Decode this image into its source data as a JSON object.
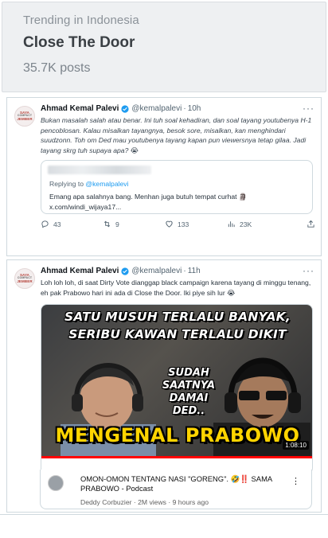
{
  "trend": {
    "label": "Trending in Indonesia",
    "title": "Close The Door",
    "posts": "35.7K posts"
  },
  "avatar": {
    "line1": "SAYA",
    "line2": "COMPACT",
    "line3": "JEMBER"
  },
  "tweet1": {
    "name": "Ahmad Kemal Palevi",
    "handle": "@kemalpalevi",
    "dot": "·",
    "time": "10h",
    "text": "Bukan masalah salah atau benar. Ini tuh soal kehadiran, dan soal tayang youtubenya H-1 pencoblosan. Kalau misalkan tayangnya, besok sore, misalkan, kan menghindari suudzonn. Toh om Ded mau youtubenya tayang kapan pun viewersnya tetap gilaa. Jadi tayang skrg tuh supaya apa? 😭",
    "quote": {
      "replying_prefix": "Replying to ",
      "replying_handle": "@kemalpalevi",
      "text": "Emang apa salahnya bang. Menhan juga butuh tempat curhat 🗿 x.com/windi_wijaya17..."
    },
    "actions": {
      "replies": "43",
      "reposts": "9",
      "likes": "133",
      "views": "23K"
    }
  },
  "tweet2": {
    "name": "Ahmad Kemal Palevi",
    "handle": "@kemalpalevi",
    "dot": "·",
    "time": "11h",
    "text": "Loh loh loh, di saat Dirty Vote dianggap black campaign karena tayang di minggu tenang, eh pak Prabowo hari ini ada di Close the Door. Iki piye sih lur 😭",
    "thumbnail": {
      "line1": "SATU MUSUH TERLALU BANYAK,",
      "line2": "SERIBU KAWAN TERLALU DIKIT",
      "bubble": "SUDAH SAATNYA DAMAI DED..",
      "headline": "MENGENAL PRABOWO",
      "duration": "1:08:10"
    },
    "video": {
      "title": "OMON-OMON TENTANG NASI \"GORENG\". 🤣‼️ SAMA PRABOWO - Podcast",
      "channel": "Deddy Corbuzier",
      "sep": "·",
      "views": "2M views",
      "ago": "9 hours ago",
      "more": "⋮"
    }
  },
  "more_label": "···",
  "colors": {
    "accent": "#1d9bf0",
    "text": "#0f1419",
    "muted": "#536471",
    "border": "#cfd9de",
    "thumb_yellow": "#ffd400"
  }
}
